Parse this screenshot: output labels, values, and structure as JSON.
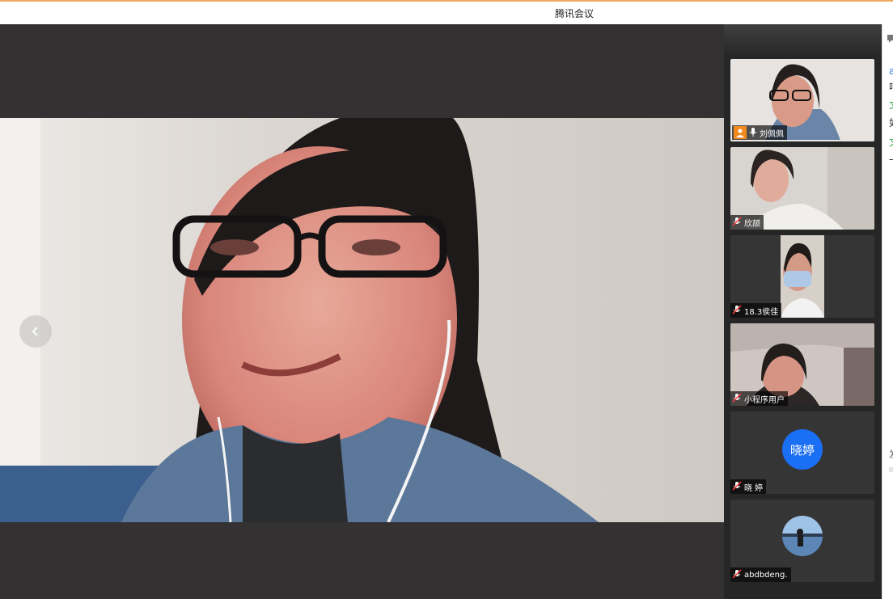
{
  "window": {
    "title": "腾讯会议"
  },
  "colors": {
    "accent_orange": "#f08a1e",
    "avatar_blue": "#1b6ff5",
    "stage_bg": "#333131",
    "sidebar_bg": "#262626"
  },
  "main_video": {
    "prev_icon": "chevron-left-icon"
  },
  "participants": [
    {
      "name": "刘佩佩",
      "host": true,
      "mic": "mic-on-icon"
    },
    {
      "name": "欣颉",
      "mic": "mic-muted-icon"
    },
    {
      "name": "18.3侯佳",
      "mic": "mic-muted-icon"
    },
    {
      "name": "小程序用户",
      "mic": "mic-muted-icon"
    },
    {
      "name": "晓 婷",
      "avatar_text": "晓婷",
      "mic": "mic-muted-icon"
    },
    {
      "name": "abdbdeng.",
      "mic": "mic-muted-icon"
    }
  ],
  "chat_panel": {
    "icon": "chat-icon",
    "fragments": [
      "a",
      "呵",
      "文",
      "如",
      "文",
      "一",
      "发"
    ]
  }
}
